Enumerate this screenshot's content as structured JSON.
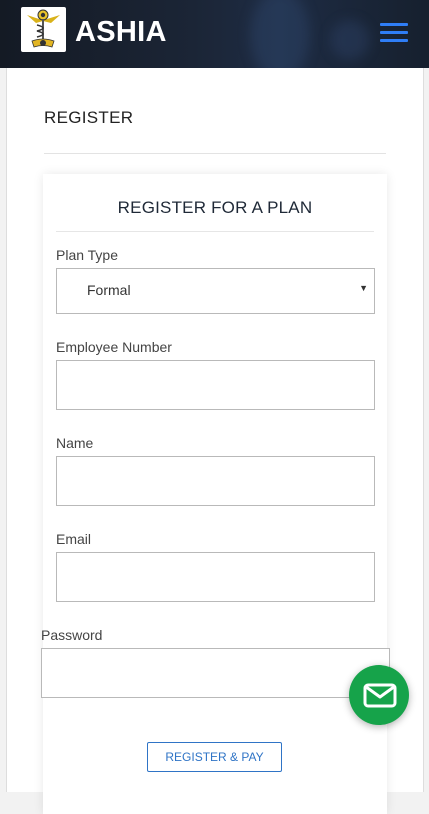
{
  "header": {
    "brand": "ASHIA",
    "logo_icon": "caduceus-logo-icon",
    "menu_icon": "hamburger-menu-icon"
  },
  "page": {
    "title": "REGISTER"
  },
  "form": {
    "title": "REGISTER FOR A PLAN",
    "plan_type": {
      "label": "Plan Type",
      "value": "Formal"
    },
    "employee_number": {
      "label": "Employee Number",
      "value": ""
    },
    "name": {
      "label": "Name",
      "value": ""
    },
    "email": {
      "label": "Email",
      "value": ""
    },
    "password": {
      "label": "Password",
      "value": ""
    },
    "submit_label": "REGISTER & PAY"
  },
  "fab": {
    "icon": "envelope-icon"
  },
  "colors": {
    "header_bg": "#1b2536",
    "accent_blue": "#2f7ef6",
    "button_blue": "#2f74c6",
    "fab_green": "#16a34a"
  }
}
